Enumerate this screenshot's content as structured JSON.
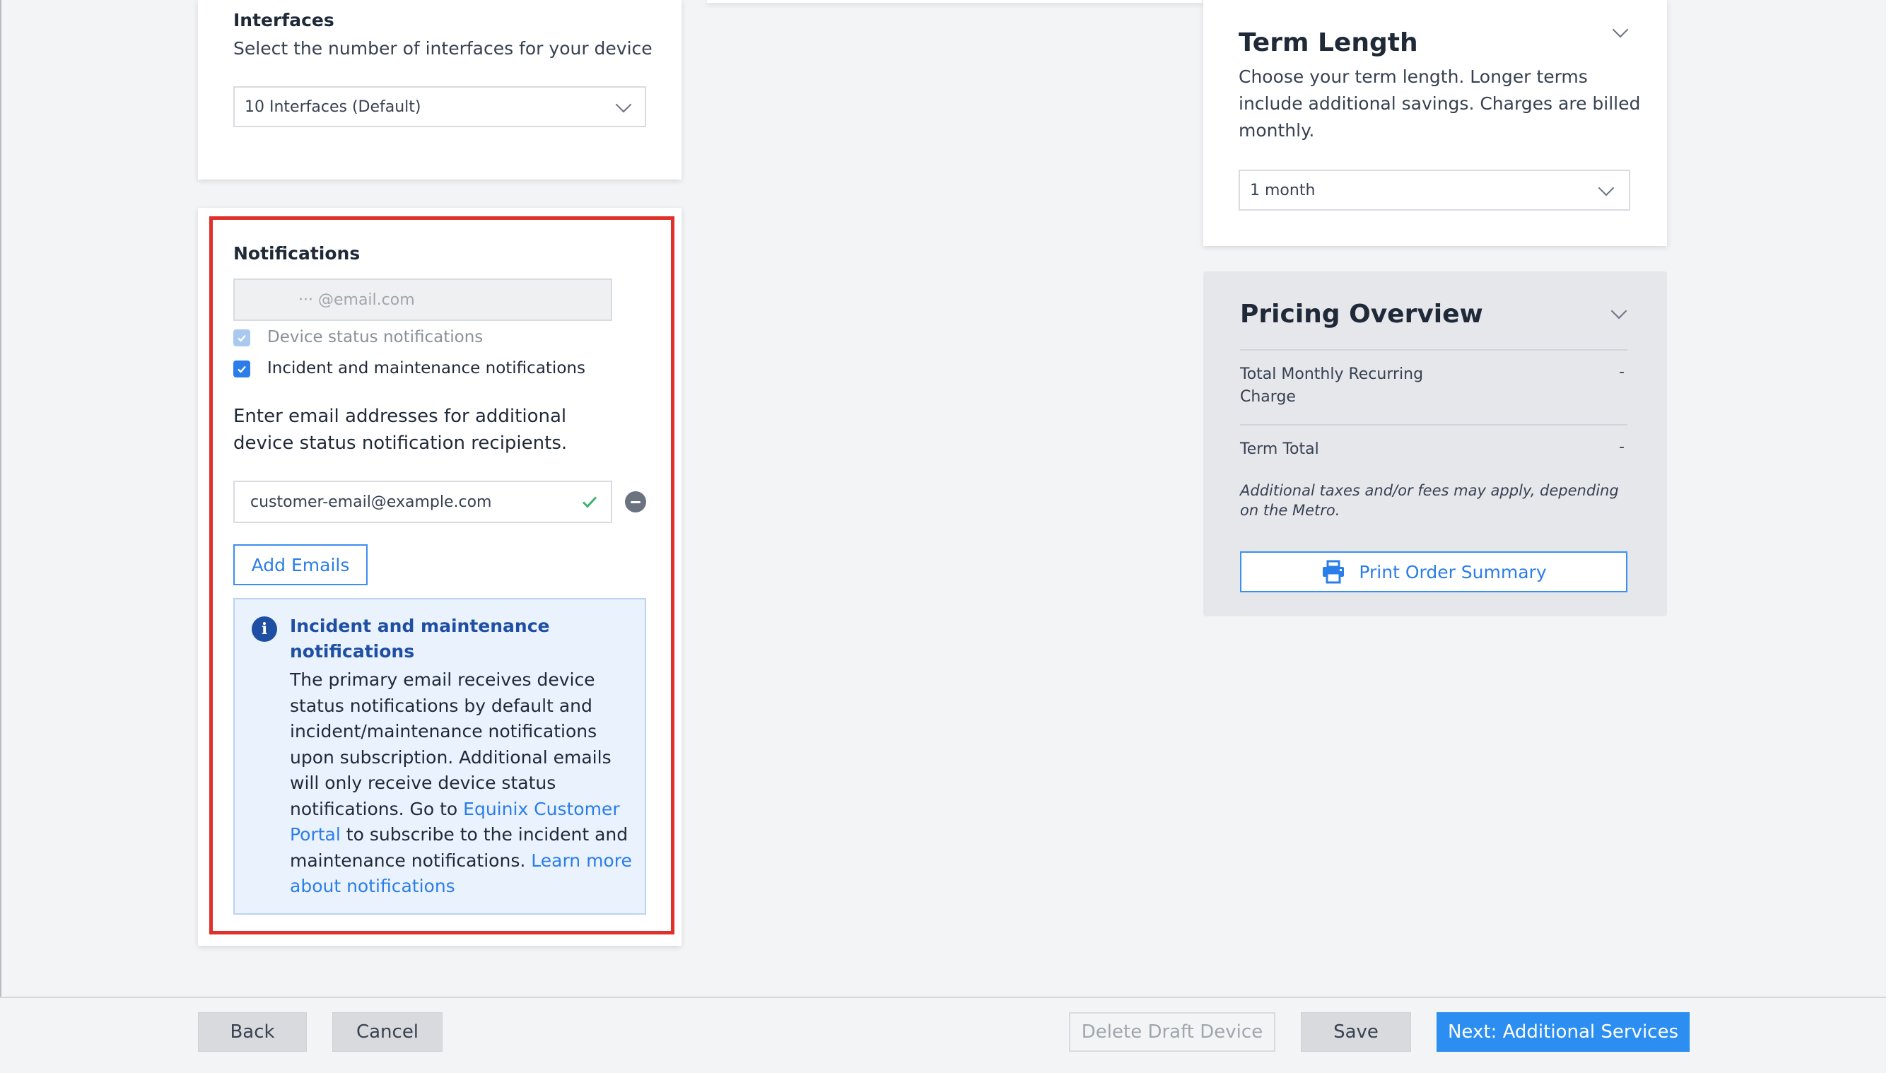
{
  "interfaces": {
    "title": "Interfaces",
    "subtitle": "Select the number of interfaces for your device",
    "selected": "10 Interfaces (Default)"
  },
  "notifications": {
    "title": "Notifications",
    "primary_email": "··· @email.com",
    "checkbox_device_status": "Device status notifications",
    "checkbox_incident": "Incident and maintenance notifications",
    "additional_prompt": "Enter email addresses for additional device status notification recipients.",
    "additional_email_value": "customer-email@example.com",
    "add_emails_label": "Add Emails",
    "info": {
      "title": "Incident and maintenance notifications",
      "body_1": "The primary email receives device status notifications by default and incident/maintenance notifications upon subscription. Additional emails will only receive device status notifications. Go to ",
      "link_portal": "Equinix Customer Portal",
      "body_2": " to subscribe to the incident and maintenance notifications. ",
      "link_learn": "Learn more about notifications"
    }
  },
  "term": {
    "title": "Term Length",
    "description": "Choose your term length. Longer terms include additional savings. Charges are billed monthly.",
    "selected": "1 month"
  },
  "pricing": {
    "title": "Pricing Overview",
    "rows": [
      {
        "label": "Total Monthly Recurring Charge",
        "value": "-"
      },
      {
        "label": "Term Total",
        "value": "-"
      }
    ],
    "disclaimer": "Additional taxes and/or fees may apply, depending on the Metro.",
    "print_label": "Print Order Summary"
  },
  "footer": {
    "back": "Back",
    "cancel": "Cancel",
    "delete_draft": "Delete Draft Device",
    "save": "Save",
    "next": "Next: Additional Services"
  },
  "colors": {
    "accent": "#2b7de9",
    "primary_button": "#2b8ef0",
    "highlight": "#e0302a",
    "info_bg": "#eaf2fd",
    "success_check": "#3cb371"
  },
  "icons": {
    "select_chevron": "chevron-down-icon",
    "info": "info-icon",
    "valid": "check-icon",
    "remove": "minus-circle-icon",
    "print": "printer-icon"
  }
}
